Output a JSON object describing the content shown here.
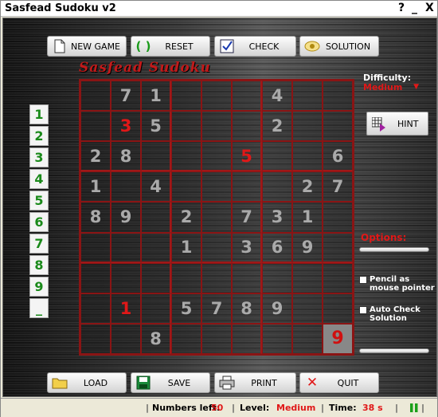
{
  "window": {
    "title": "Sasfead Sudoku  v2",
    "help_glyph": "?",
    "min_glyph": "_",
    "close_glyph": "X"
  },
  "toolbar_top": [
    {
      "label": "NEW GAME",
      "icon": "document-icon"
    },
    {
      "label": "RESET",
      "icon": "reset-icon"
    },
    {
      "label": "CHECK",
      "icon": "checkmark-icon"
    },
    {
      "label": "SOLUTION",
      "icon": "eye-icon"
    }
  ],
  "logo": "Sasfead Sudoku",
  "difficulty": {
    "label": "Difficulty:",
    "value": "Medium"
  },
  "hint_label": "HINT",
  "options_label": "Options:",
  "options": [
    {
      "label_line1": "Pencil as",
      "label_line2": "mouse pointer",
      "checked": false
    },
    {
      "label_line1": "Auto Check",
      "label_line2": "Solution",
      "checked": false
    }
  ],
  "numpad": [
    "1",
    "2",
    "3",
    "4",
    "5",
    "6",
    "7",
    "8",
    "9",
    "_"
  ],
  "grid": [
    [
      "",
      "7",
      "1",
      "",
      "",
      "",
      "4",
      "",
      ""
    ],
    [
      "",
      "3",
      "5",
      "",
      "",
      "",
      "2",
      "",
      ""
    ],
    [
      "2",
      "8",
      "",
      "",
      "",
      "5",
      "",
      "",
      "6"
    ],
    [
      "1",
      "",
      "4",
      "",
      "",
      "",
      "",
      "2",
      "7"
    ],
    [
      "8",
      "9",
      "",
      "2",
      "",
      "7",
      "3",
      "1",
      ""
    ],
    [
      "",
      "",
      "",
      "1",
      "",
      "3",
      "6",
      "9",
      ""
    ],
    [
      "",
      "",
      "",
      "",
      "",
      "",
      "",
      "",
      ""
    ],
    [
      "",
      "1",
      "",
      "5",
      "7",
      "8",
      "9",
      "",
      ""
    ],
    [
      "",
      "",
      "8",
      "",
      "",
      "",
      "",
      "",
      "9"
    ]
  ],
  "red_cells": [
    [
      1,
      1
    ],
    [
      2,
      5
    ],
    [
      7,
      1
    ],
    [
      8,
      8
    ]
  ],
  "selected_cell": [
    8,
    8
  ],
  "toolbar_bottom": [
    {
      "label": "LOAD",
      "icon": "folder-icon"
    },
    {
      "label": "SAVE",
      "icon": "floppy-icon"
    },
    {
      "label": "PRINT",
      "icon": "printer-icon"
    },
    {
      "label": "QUIT",
      "icon": "x-icon"
    }
  ],
  "status": {
    "numbers_left_label": "Numbers left:",
    "numbers_left": "50",
    "level_label": "Level:",
    "level": "Medium",
    "time_label": "Time:",
    "time": "38 s"
  },
  "colors": {
    "accent_red": "#e01818",
    "numpad_green": "#1a8a1a",
    "grid_line": "#8a1414"
  }
}
